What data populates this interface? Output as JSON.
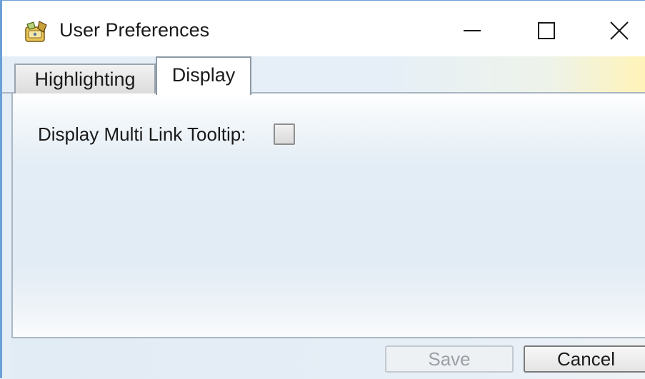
{
  "window": {
    "title": "User Preferences",
    "icon": "preferences-app-icon",
    "controls": {
      "minimize": "minimize-icon",
      "maximize": "maximize-icon",
      "close": "close-icon"
    }
  },
  "tabs": [
    {
      "label": "Highlighting",
      "selected": false
    },
    {
      "label": "Display",
      "selected": true
    }
  ],
  "display_tab": {
    "multi_link_tooltip_label": "Display Multi Link Tooltip:",
    "multi_link_tooltip_checked": false
  },
  "footer": {
    "save_label": "Save",
    "save_enabled": false,
    "cancel_label": "Cancel"
  },
  "colors": {
    "window_border": "#6aa0d6",
    "disabled_text": "#9aa0a6"
  }
}
